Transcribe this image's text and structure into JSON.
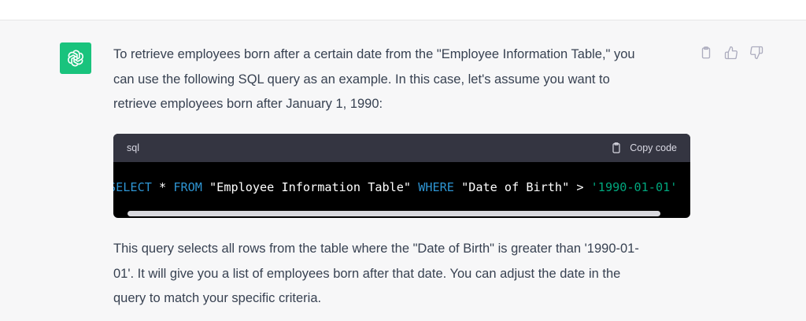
{
  "message": {
    "avatar_icon": "openai-logo-icon",
    "avatar_color": "#19c37d",
    "intro_line1": "To retrieve employees born after a certain date from the \"Employee Information Table,\" you",
    "intro_line2": "can use the following SQL query as an example. In this case, let's assume you want to",
    "intro_line3": "retrieve employees born after January 1, 1990:",
    "outro_line1": "This query selects all rows from the table where the \"Date of Birth\" is greater than '1990-01-",
    "outro_line2": "01'. It will give you a list of employees born after that date. You can adjust the date in the",
    "outro_line3": "query to match your specific criteria."
  },
  "actions": {
    "copy_icon": "clipboard-icon",
    "like_icon": "thumbs-up-icon",
    "dislike_icon": "thumbs-down-icon"
  },
  "code_block": {
    "language": "sql",
    "copy_label": "Copy code",
    "tokens": {
      "select": "SELECT",
      "star": " * ",
      "from": "FROM",
      "table": " \"Employee Information Table\" ",
      "where": "WHERE",
      "column": " \"Date of Birth\" > ",
      "value": "'1990-01-01'"
    },
    "keyword_color": "#2e95d3",
    "string_color": "#00a67d"
  }
}
